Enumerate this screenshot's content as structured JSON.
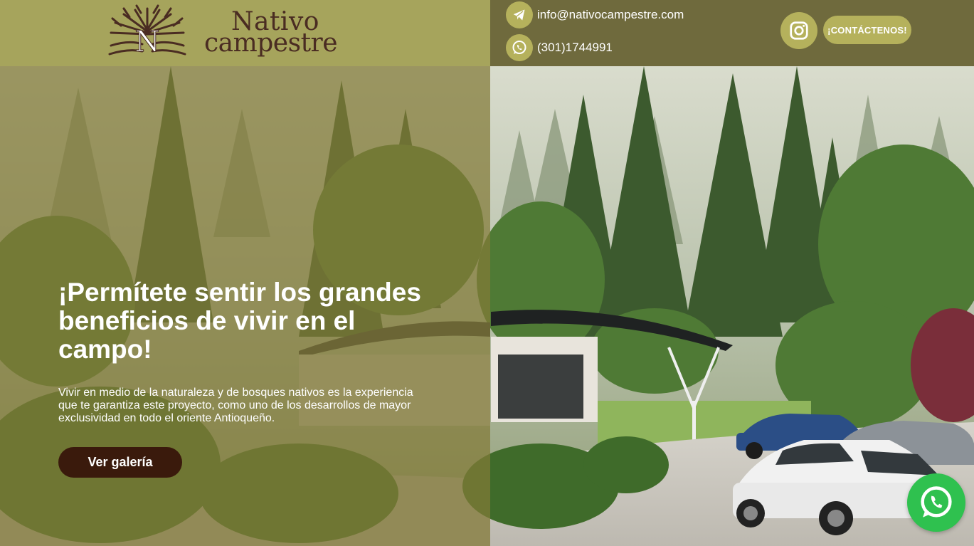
{
  "brand": {
    "logo_mark": "N",
    "name_line1": "Nativo",
    "name_line2": "campestre"
  },
  "header": {
    "email": "info@nativocampestre.com",
    "phone": "(301)1744991",
    "email_icon": "telegram-icon",
    "phone_icon": "whatsapp-icon",
    "social_icon": "instagram-icon",
    "contact_button_label": "¡CONTÁCTENOS!",
    "colors": {
      "header_left": "#a6a45c",
      "header_right": "#6f6a3d",
      "icon_circle": "#b5b15c"
    }
  },
  "hero": {
    "title": "¡Permítete sentir los grandes beneficios de vivir en el campo!",
    "description": "Vivir en medio de la naturaleza y de bosques nativos es la experiencia que te garantiza este proyecto, como uno de los desarrollos de mayor exclusividad en todo el oriente Antioqueño.",
    "gallery_button_label": "Ver galería",
    "colors": {
      "gallery_button": "#3a1a0c",
      "overlay": "#827a37"
    }
  },
  "floating": {
    "whatsapp_icon": "whatsapp-icon",
    "color": "#2fc14f"
  }
}
